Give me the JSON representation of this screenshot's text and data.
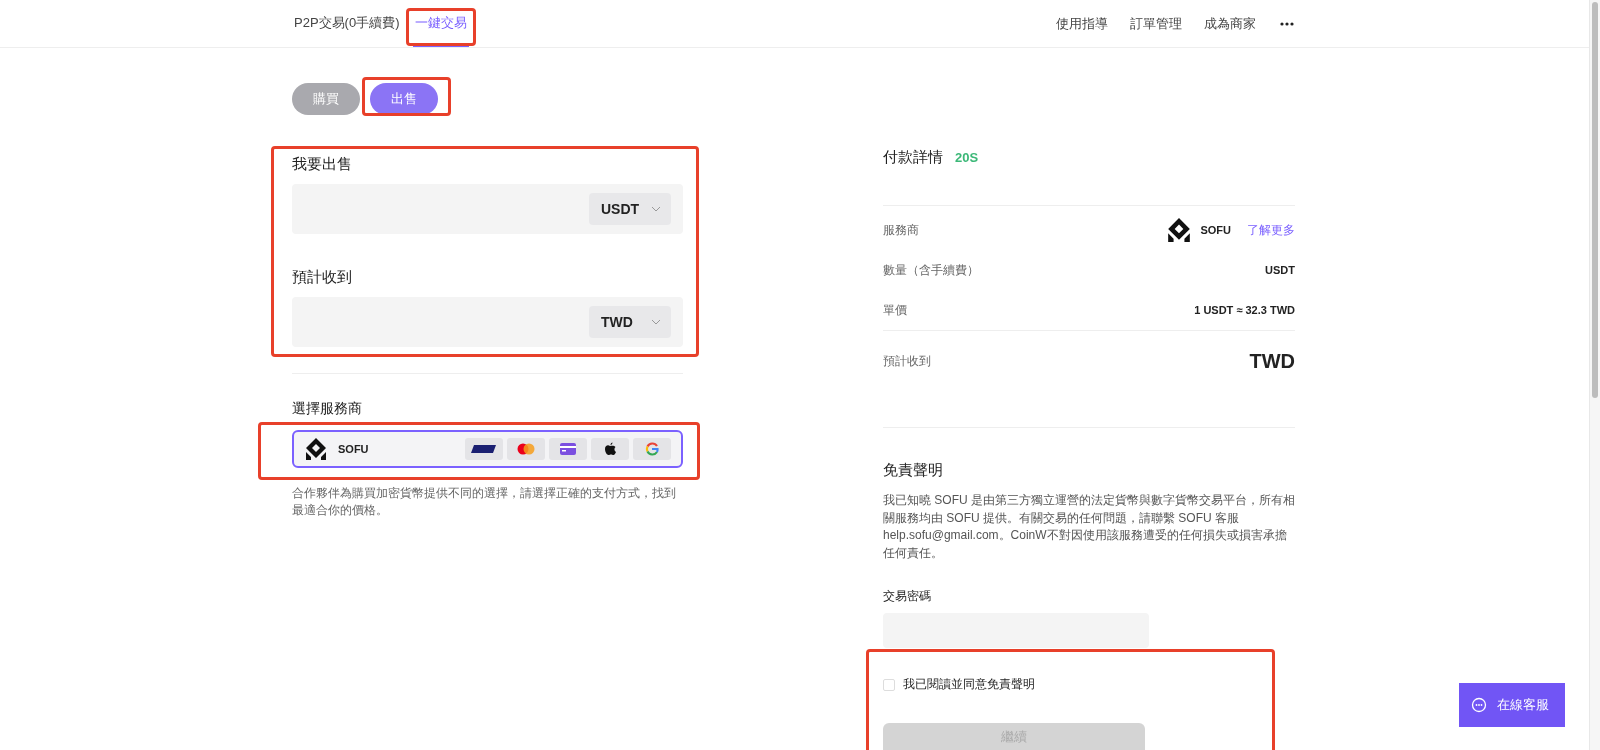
{
  "nav": {
    "tabs": [
      {
        "label": "P2P交易(0手續費)",
        "selected": false
      },
      {
        "label": "一鍵交易",
        "selected": true
      }
    ],
    "links": [
      "使用指導",
      "訂單管理",
      "成為商家"
    ]
  },
  "mode_toggle": [
    {
      "label": "購買",
      "selected": false
    },
    {
      "label": "出售",
      "selected": true
    }
  ],
  "sell_field": {
    "label": "我要出售",
    "currency": "USDT"
  },
  "receive_field": {
    "label": "預計收到",
    "currency": "TWD"
  },
  "provider": {
    "label": "選擇服務商",
    "name": "SOFU",
    "selected": true
  },
  "provider_note": "合作夥伴為購買加密貨幣提供不同的選擇，請選擇正確的支付方式，找到最適合你的價格。",
  "details": {
    "title": "付款詳情",
    "countdown": "20S",
    "rows": [
      {
        "kind": "provider",
        "label": "服務商",
        "value": "SOFU",
        "link": "了解更多"
      },
      {
        "kind": "plain",
        "label": "數量（含手續費）",
        "value": "USDT"
      },
      {
        "kind": "plain",
        "label": "單價",
        "value": "1 USDT ≈ 32.3 TWD"
      },
      {
        "kind": "total",
        "label": "預計收到",
        "value": "TWD"
      }
    ]
  },
  "disclaimer": {
    "title": "免責聲明",
    "text": "我已知曉 SOFU 是由第三方獨立運營的法定貨幣與數字貨幣交易平台，所有相關服務均由 SOFU 提供。有關交易的任何問題，請聯繫 SOFU 客服 help.sofu@gmail.com。CoinW不對因使用該服務遭受的任何損失或損害承擔任何責任。"
  },
  "password": {
    "label": "交易密碼"
  },
  "agree": {
    "label": "我已閱讀並同意免責聲明",
    "checked": false
  },
  "continue": {
    "label": "繼續",
    "disabled": true
  },
  "support": {
    "label": "在線客服"
  }
}
